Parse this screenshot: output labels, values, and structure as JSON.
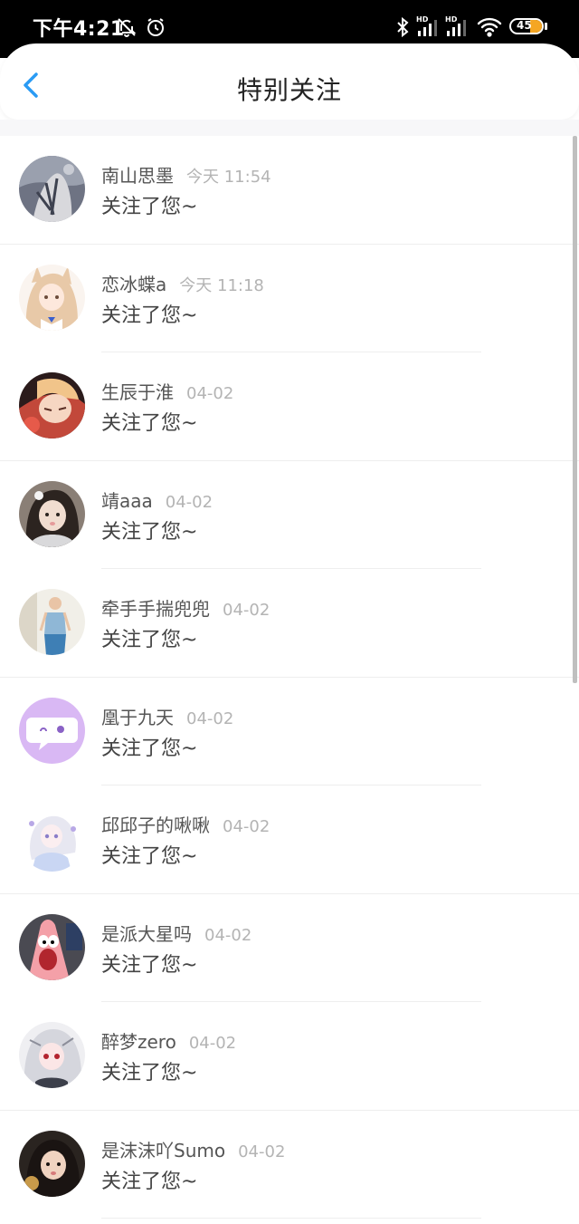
{
  "status_bar": {
    "time": "下午4:21",
    "signal_label": "HD",
    "battery_level": "45",
    "battery_color": "#f5a623"
  },
  "header": {
    "title": "特别关注",
    "back_icon": "chevron-left-icon",
    "accent_color": "#2a9bf4"
  },
  "list": {
    "items": [
      {
        "name": "南山思墨",
        "time": "今天 11:54",
        "message": "关注了您~",
        "avatar": "avatar-ink-portrait"
      },
      {
        "name": "恋冰蝶a",
        "time": "今天 11:18",
        "message": "关注了您~",
        "avatar": "avatar-anime-girl-cat-ears"
      },
      {
        "name": "生辰于淮",
        "time": "04-02",
        "message": "关注了您~",
        "avatar": "avatar-anime-boy-red"
      },
      {
        "name": "靖aaa",
        "time": "04-02",
        "message": "关注了您~",
        "avatar": "avatar-girl-photo"
      },
      {
        "name": "牵手手揣兜兜",
        "time": "04-02",
        "message": "关注了您~",
        "avatar": "avatar-person-standing"
      },
      {
        "name": "凰于九天",
        "time": "04-02",
        "message": "关注了您~",
        "avatar": "avatar-default-chat-bubble"
      },
      {
        "name": "邱邱子的啾啾",
        "time": "04-02",
        "message": "关注了您~",
        "avatar": "avatar-anime-white-hair"
      },
      {
        "name": "是派大星吗",
        "time": "04-02",
        "message": "关注了您~",
        "avatar": "avatar-patrick-star"
      },
      {
        "name": "醉梦zero",
        "time": "04-02",
        "message": "关注了您~",
        "avatar": "avatar-anime-silver-hair"
      },
      {
        "name": "是沫沫吖Sumo",
        "time": "04-02",
        "message": "关注了您~",
        "avatar": "avatar-girl-photo-dark"
      }
    ]
  }
}
